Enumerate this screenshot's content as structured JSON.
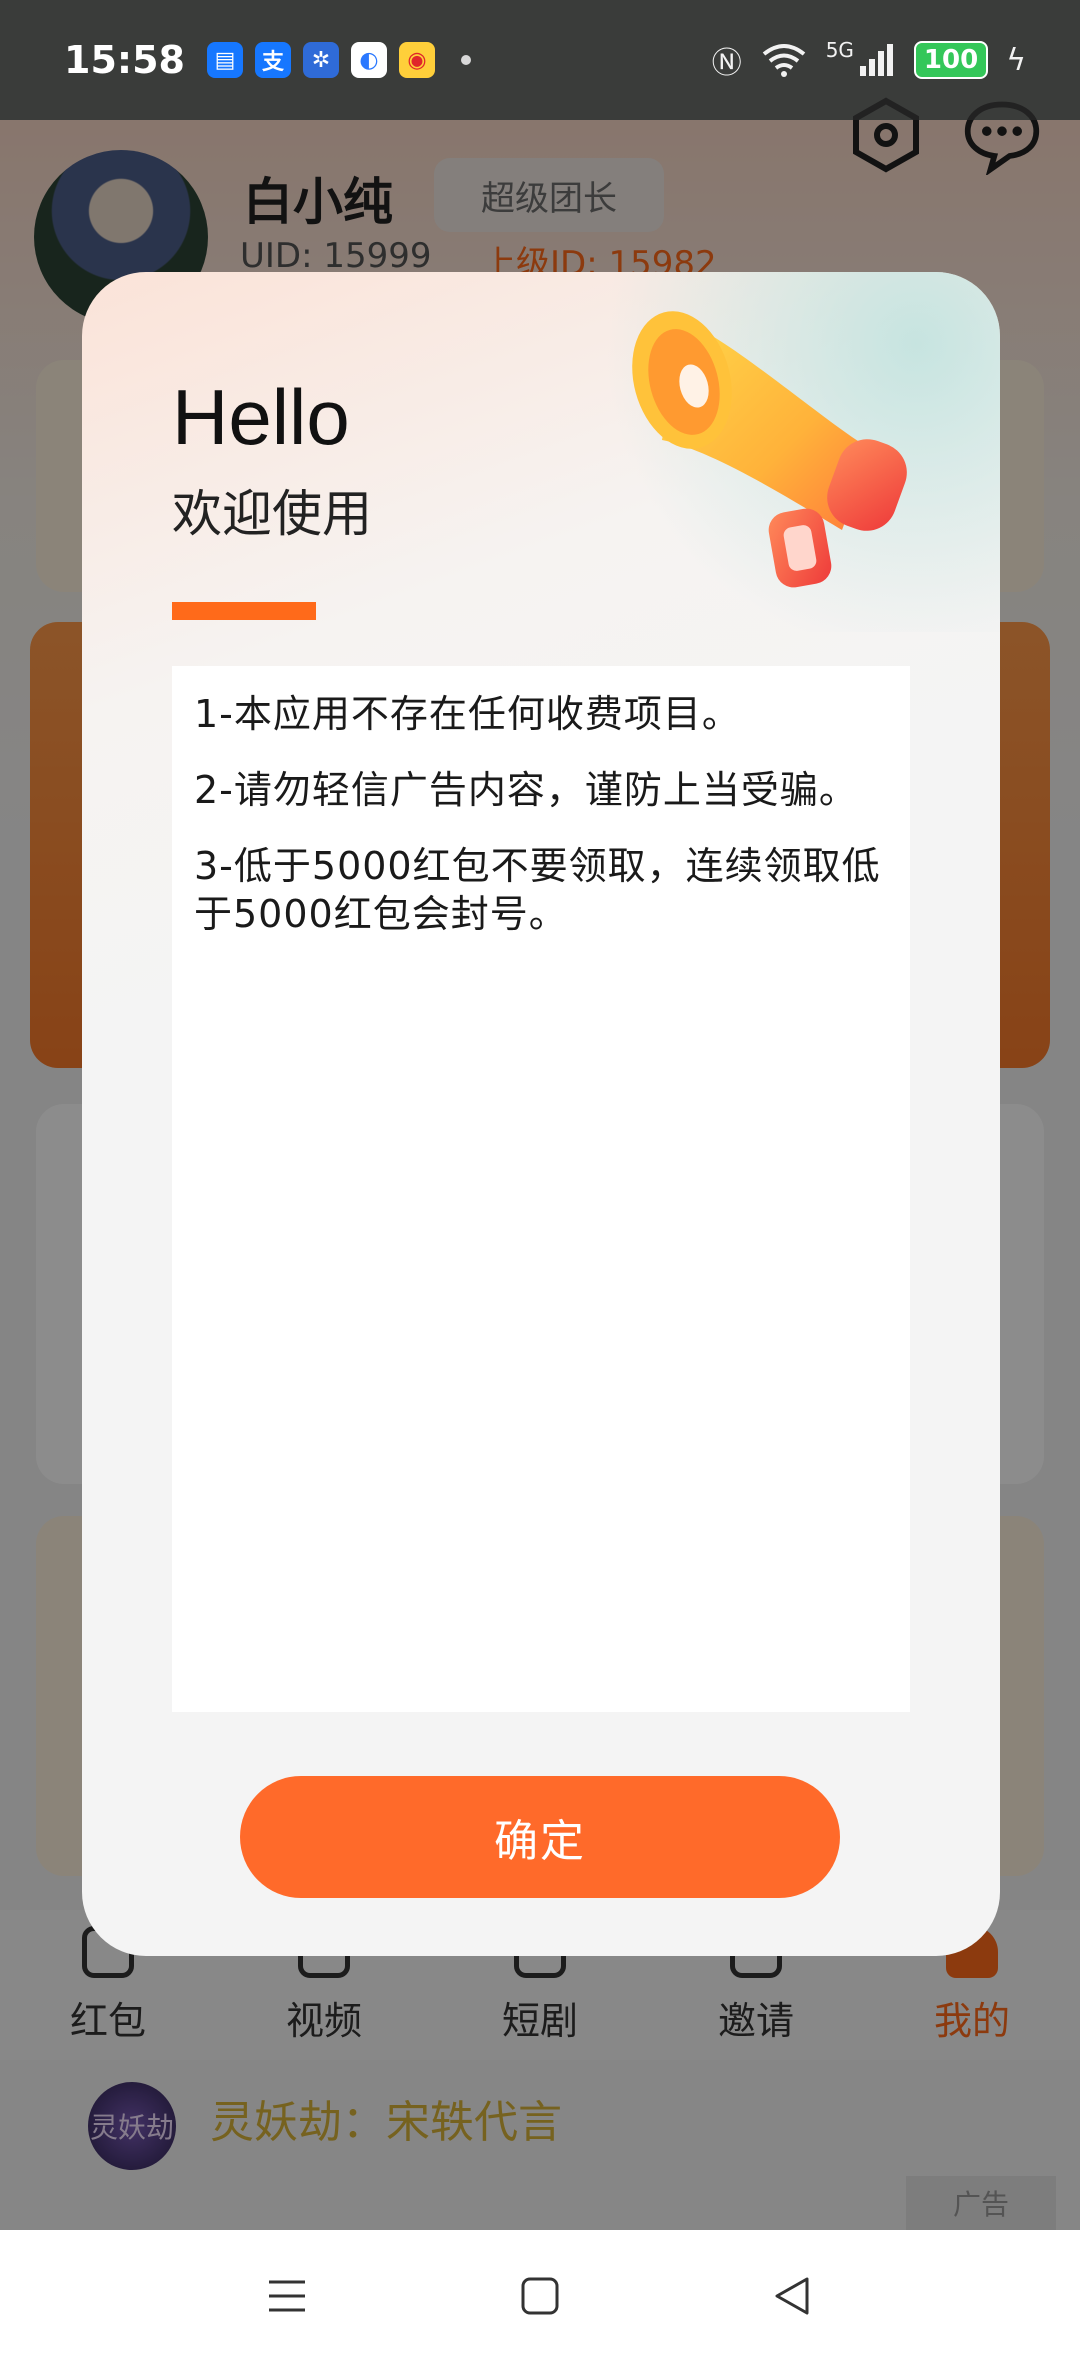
{
  "status_bar": {
    "time": "15:58",
    "battery": "100",
    "network": "5G",
    "notification_icons": [
      "message-icon",
      "alipay-icon",
      "pinwheel-icon",
      "browser-icon",
      "weibo-icon"
    ],
    "status_icons": [
      "nfc-icon",
      "wifi-icon",
      "signal-icon",
      "battery-icon",
      "charging-icon"
    ]
  },
  "background": {
    "user": {
      "name": "白小纯",
      "rank": "超级团长",
      "uid": "UID: 15999",
      "parent_id": "上级ID: 15982"
    },
    "tabs": [
      {
        "label": "红包",
        "active": false
      },
      {
        "label": "视频",
        "active": false
      },
      {
        "label": "短剧",
        "active": false
      },
      {
        "label": "邀请",
        "active": false
      },
      {
        "label": "我的",
        "active": true
      }
    ],
    "ad": {
      "logo_text": "灵妖劫",
      "text": "灵妖劫：宋轶代言",
      "tag": "广告"
    }
  },
  "modal": {
    "hello": "Hello",
    "welcome": "欢迎使用",
    "notices": [
      "1-本应用不存在任何收费项目。",
      "2-请勿轻信广告内容，谨防上当受骗。",
      "3-低于5000红包不要领取，连续领取低于5000红包会封号。"
    ],
    "confirm_label": "确定"
  },
  "colors": {
    "accent": "#ff6a2a",
    "overlay": "rgba(0,0,0,0.45)",
    "status_bar": "#3a3c3a"
  }
}
